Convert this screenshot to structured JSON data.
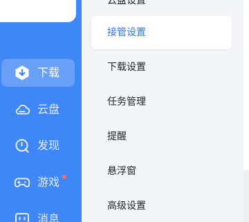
{
  "sidebar": {
    "accent": "#3f86f7",
    "items": [
      {
        "label": "下载",
        "icon": "download-icon",
        "active": true,
        "badge": false
      },
      {
        "label": "云盘",
        "icon": "cloud-icon",
        "active": false,
        "badge": false
      },
      {
        "label": "发现",
        "icon": "discover-icon",
        "active": false,
        "badge": false
      },
      {
        "label": "游戏",
        "icon": "gamepad-icon",
        "active": false,
        "badge": true,
        "badge_color": "#ff6b5a"
      },
      {
        "label": "消息",
        "icon": "message-icon",
        "active": false,
        "badge": false
      }
    ]
  },
  "settings_menu": {
    "items": [
      {
        "label": "云盘设置",
        "active": false
      },
      {
        "label": "接管设置",
        "active": true
      },
      {
        "label": "下载设置",
        "active": false
      },
      {
        "label": "任务管理",
        "active": false
      },
      {
        "label": "提醒",
        "active": false
      },
      {
        "label": "悬浮窗",
        "active": false
      },
      {
        "label": "高级设置",
        "active": false
      }
    ],
    "active_color": "#2f73e9"
  }
}
